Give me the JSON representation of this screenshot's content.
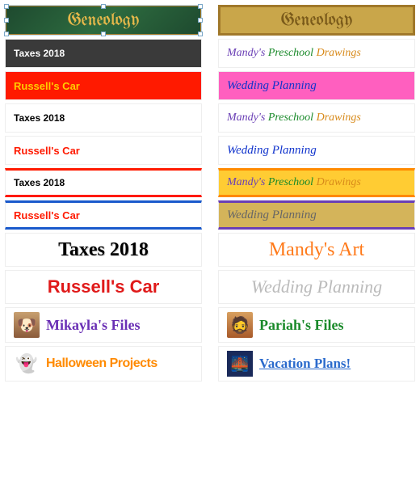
{
  "row1": {
    "left": "Geneology",
    "right": "Geneology"
  },
  "row2": {
    "taxes": "Taxes 2018",
    "mandy": {
      "w1": "Mandy's",
      "w2": "Preschool",
      "w3": "Drawings"
    }
  },
  "row3": {
    "russell": "Russell's Car",
    "wedding": "Wedding Planning"
  },
  "row_big": {
    "taxes": "Taxes 2018",
    "mandy": "Mandy's Art",
    "russell": "Russell's Car",
    "wedding": "Wedding Planning"
  },
  "row_bottom": {
    "mikayla": "Mikayla's Files",
    "pariah": "Pariah's Files",
    "halloween": "Halloween Projects",
    "vacation": "Vacation Plans!"
  },
  "icons": {
    "ghost": "👻",
    "bridge": "🌉"
  }
}
